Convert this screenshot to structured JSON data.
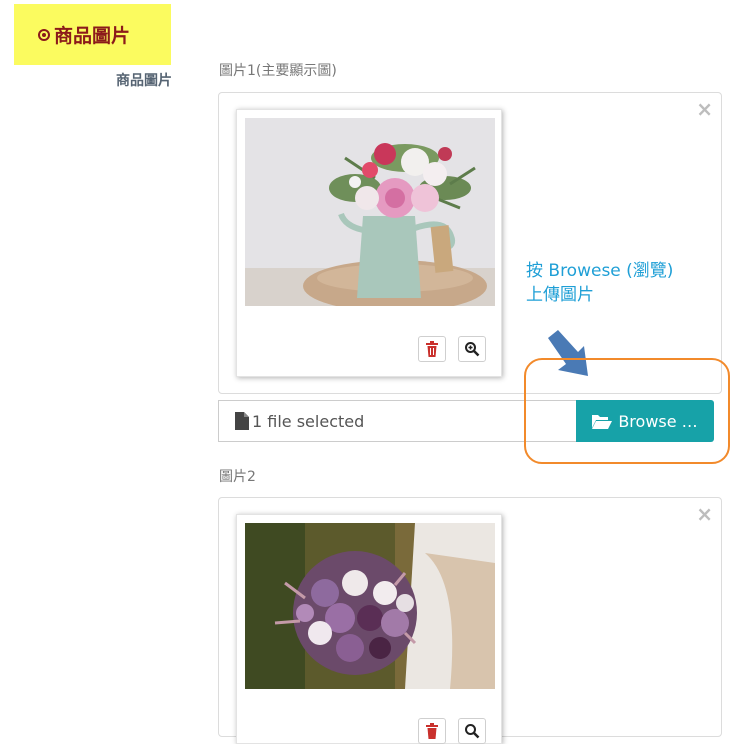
{
  "section": {
    "title": "商品圖片"
  },
  "row_label": "商品圖片",
  "images": [
    {
      "label": "圖片1(主要顯示圖)",
      "close_glyph": "×",
      "photo": "flowers in a mint watering can with tag"
    },
    {
      "label": "圖片2",
      "close_glyph": "×",
      "photo": "bridal bouquet of purple and white roses"
    }
  ],
  "file_input": {
    "caption": "1 file selected",
    "browse_label": "Browse …"
  },
  "annotation": {
    "line1": "按 Browese (瀏覽)",
    "line2": "上傳圖片"
  },
  "colors": {
    "badge_bg": "#fbfb5f",
    "badge_text": "#8b1a1a",
    "browse_bg": "#17a2a8",
    "annotation_text": "#1f9fd6",
    "highlight": "#f28a2b",
    "arrow": "#4a7ab5"
  }
}
